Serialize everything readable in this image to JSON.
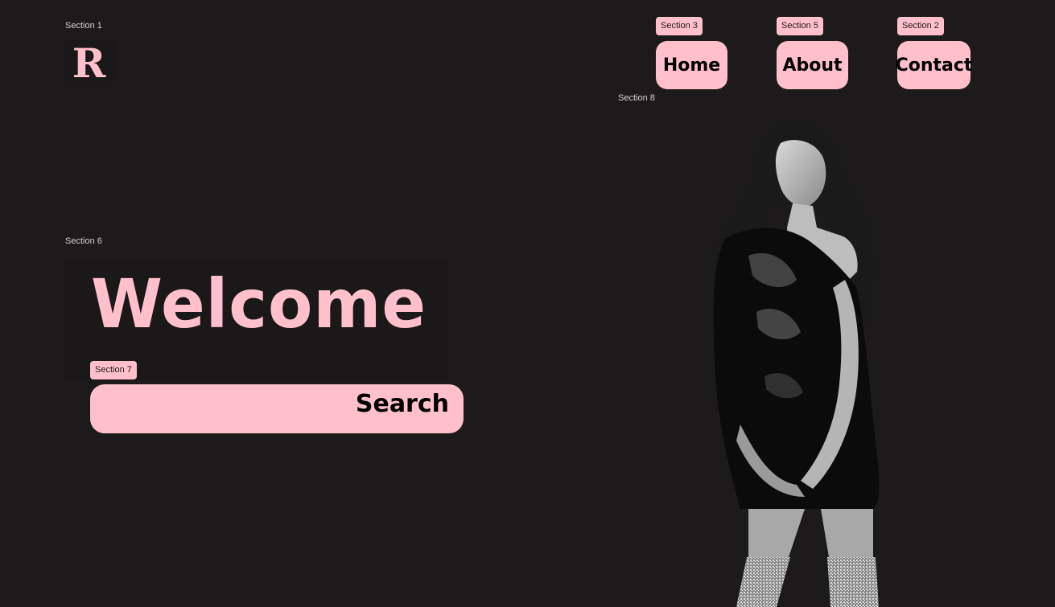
{
  "sections": {
    "s1": "Section 1",
    "s2": "Section 2",
    "s3": "Section 3",
    "s5": "Section 5",
    "s6": "Section 6",
    "s7": "Section 7",
    "s8": "Section 8"
  },
  "logo": {
    "letter": "R"
  },
  "nav": {
    "home": "Home",
    "about": "About",
    "contact": "Contact"
  },
  "hero": {
    "title": "Welcome",
    "search_label": "Search",
    "search_value": ""
  },
  "colors": {
    "background": "#1c1a1a",
    "accent": "#ffc0cb",
    "text_dark": "#000000"
  },
  "image": {
    "subject": "woman-in-black-dress-photo"
  }
}
